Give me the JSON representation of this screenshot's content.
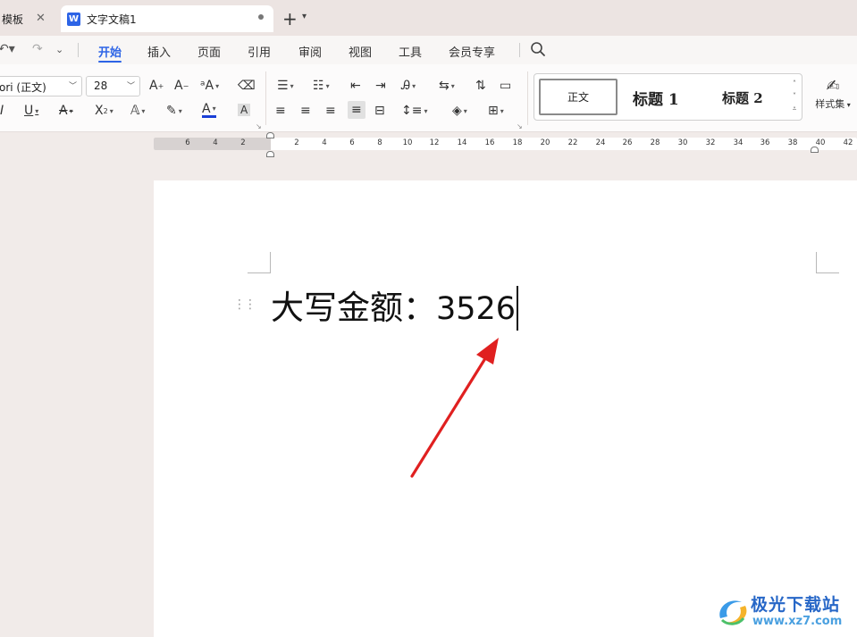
{
  "tabs": {
    "templates_label": "模板",
    "doc_icon": "W",
    "doc_label": "文字文稿1",
    "new_tab": "+",
    "close_glyph": "✕"
  },
  "menu": {
    "items": [
      "开始",
      "插入",
      "页面",
      "引用",
      "审阅",
      "视图",
      "工具",
      "会员专享"
    ],
    "active": "开始"
  },
  "ribbon": {
    "font_name": "ori (正文)",
    "font_size": "28",
    "styles": {
      "normal": "正文",
      "heading1": "标题 1",
      "heading2": "标题 2"
    },
    "style_set_label": "样式集"
  },
  "ruler": {
    "labels": [
      "6",
      "4",
      "2",
      "2",
      "4",
      "6",
      "8",
      "10",
      "12",
      "14",
      "16",
      "18",
      "20",
      "22",
      "24",
      "26",
      "28",
      "30",
      "32",
      "34",
      "36",
      "38",
      "40",
      "42"
    ]
  },
  "document": {
    "label": "大写金额：",
    "value": "3526"
  },
  "watermark": {
    "title": "极光下载站",
    "url": "www.xz7.com"
  },
  "colors": {
    "accent": "#2d64e6",
    "arrow": "#e02020",
    "font_color_bar": "#1a3fd6"
  }
}
